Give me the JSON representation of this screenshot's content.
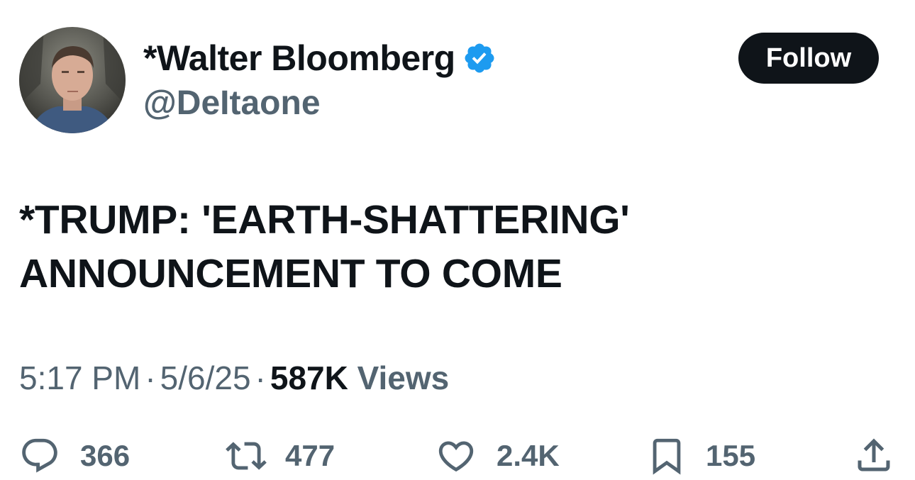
{
  "author": {
    "display_name": "*Walter Bloomberg",
    "handle": "@DeItaone",
    "verified": true,
    "avatar_icon": "profile-photo"
  },
  "follow_label": "Follow",
  "tweet": {
    "lines": [
      "*TRUMP: 'EARTH-SHATTERING'",
      "ANNOUNCEMENT TO COME"
    ]
  },
  "meta": {
    "time": "5:17 PM",
    "separator": "·",
    "date": "5/6/25",
    "views_count": "587K",
    "views_label": "Views"
  },
  "actions": {
    "replies": "366",
    "reposts": "477",
    "likes": "2.4K",
    "bookmarks": "155"
  },
  "colors": {
    "text_primary": "#0f1419",
    "text_secondary": "#536471",
    "verified_blue": "#1d9bf0",
    "follow_bg": "#0f1419"
  }
}
